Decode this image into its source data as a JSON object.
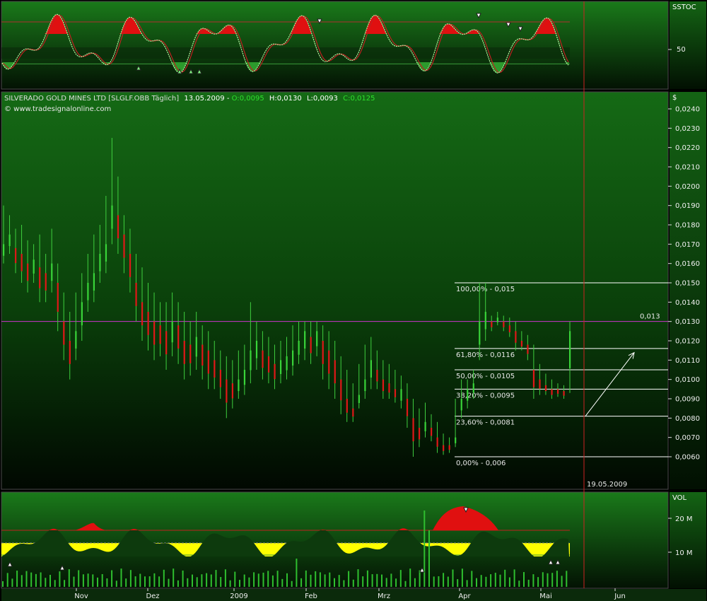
{
  "header": {
    "name": "SILVERADO GOLD MINES LTD [SLGLF.OBB Täglich]",
    "date": "13.05.2009",
    "open_label": "O:",
    "open": "0,0095",
    "high_label": "H:",
    "high": "0,0130",
    "low_label": "L:",
    "low": "0,0093",
    "close_label": "C:",
    "close": "0,0125",
    "copyright": "© www.tradesignalonline.com"
  },
  "panels": {
    "stoch": {
      "name": "SSTOC",
      "tick_label": "50"
    },
    "price": {
      "name": "$"
    },
    "volume": {
      "name": "VOL",
      "tick_labels": [
        "20 M",
        "10 M"
      ]
    }
  },
  "chart_data": {
    "type": "bar",
    "title": "SILVERADO GOLD MINES LTD [SLGLF.OBB Täglich]",
    "x_ticks": [
      "Nov",
      "Dez",
      "2009",
      "Feb",
      "Mrz",
      "Apr",
      "Mai",
      "Jun"
    ],
    "y_ticks": [
      "0,0240",
      "0,0230",
      "0,0220",
      "0,0210",
      "0,0200",
      "0,0190",
      "0,0180",
      "0,0170",
      "0,0160",
      "0,0150",
      "0,0140",
      "0,0130",
      "0,0120",
      "0,0110",
      "0,0100",
      "0,0090",
      "0,0080",
      "0,0070",
      "0,0060"
    ],
    "ylim": [
      0.0055,
      0.0245
    ],
    "horizontal_line": {
      "value": 0.013,
      "label": "0,013",
      "color": "#cc33cc"
    },
    "fibonacci": [
      {
        "label": "100,00% - 0,015",
        "value": 0.015
      },
      {
        "label": "61,80% - 0,0116",
        "value": 0.0116
      },
      {
        "label": "50,00% - 0,0105",
        "value": 0.0105
      },
      {
        "label": "38,20% - 0,0095",
        "value": 0.0095
      },
      {
        "label": "23,60% - 0,0081",
        "value": 0.0081
      },
      {
        "label": "0,00% - 0,006",
        "value": 0.006
      }
    ],
    "vertical_marker": {
      "label": "19.05.2009",
      "color": "#cc2222"
    },
    "arrow": {
      "from": [
        0.0081,
        0
      ],
      "to": [
        0.0115,
        0
      ]
    },
    "series": [
      {
        "name": "",
        "values": [
          [
            0.017,
            0.019,
            0.016
          ],
          [
            0.0175,
            0.0185,
            0.0165
          ],
          [
            0.0168,
            0.0178,
            0.0155
          ],
          [
            0.0165,
            0.018,
            0.015
          ],
          [
            0.016,
            0.0172,
            0.0145
          ],
          [
            0.0162,
            0.017,
            0.015
          ],
          [
            0.0158,
            0.0175,
            0.014
          ],
          [
            0.0155,
            0.0165,
            0.014
          ],
          [
            0.016,
            0.0178,
            0.0145
          ],
          [
            0.015,
            0.016,
            0.0125
          ],
          [
            0.013,
            0.0145,
            0.011
          ],
          [
            0.012,
            0.0135,
            0.01
          ],
          [
            0.0125,
            0.0145,
            0.011
          ],
          [
            0.014,
            0.0155,
            0.012
          ],
          [
            0.015,
            0.0165,
            0.0135
          ],
          [
            0.0155,
            0.0175,
            0.014
          ],
          [
            0.0165,
            0.018,
            0.015
          ],
          [
            0.017,
            0.0195,
            0.0155
          ],
          [
            0.019,
            0.0225,
            0.017
          ],
          [
            0.0185,
            0.0205,
            0.0165
          ],
          [
            0.0175,
            0.0185,
            0.0155
          ],
          [
            0.0165,
            0.0178,
            0.0145
          ],
          [
            0.015,
            0.0165,
            0.013
          ],
          [
            0.014,
            0.0158,
            0.012
          ],
          [
            0.0135,
            0.015,
            0.0115
          ],
          [
            0.013,
            0.0145,
            0.011
          ],
          [
            0.0128,
            0.014,
            0.0112
          ],
          [
            0.0125,
            0.014,
            0.0105
          ],
          [
            0.013,
            0.0145,
            0.0112
          ],
          [
            0.0128,
            0.014,
            0.0108
          ],
          [
            0.012,
            0.0135,
            0.01
          ],
          [
            0.0118,
            0.013,
            0.0102
          ],
          [
            0.0122,
            0.0135,
            0.0105
          ],
          [
            0.0118,
            0.0128,
            0.01
          ],
          [
            0.0115,
            0.0125,
            0.0095
          ],
          [
            0.011,
            0.012,
            0.0095
          ],
          [
            0.0105,
            0.0115,
            0.009
          ],
          [
            0.01,
            0.0112,
            0.008
          ],
          [
            0.0098,
            0.011,
            0.0085
          ],
          [
            0.01,
            0.0115,
            0.009
          ],
          [
            0.0105,
            0.0118,
            0.0092
          ],
          [
            0.0115,
            0.014,
            0.0098
          ],
          [
            0.012,
            0.013,
            0.0105
          ],
          [
            0.0115,
            0.0125,
            0.01
          ],
          [
            0.0112,
            0.0122,
            0.0098
          ],
          [
            0.0108,
            0.0118,
            0.0095
          ],
          [
            0.011,
            0.012,
            0.0098
          ],
          [
            0.0112,
            0.0122,
            0.01
          ],
          [
            0.0115,
            0.0128,
            0.0102
          ],
          [
            0.012,
            0.013,
            0.0108
          ],
          [
            0.0125,
            0.013,
            0.011
          ],
          [
            0.0122,
            0.013,
            0.0108
          ],
          [
            0.0125,
            0.013,
            0.0112
          ],
          [
            0.012,
            0.0128,
            0.01
          ],
          [
            0.0115,
            0.0125,
            0.0095
          ],
          [
            0.011,
            0.012,
            0.009
          ],
          [
            0.01,
            0.0112,
            0.0082
          ],
          [
            0.009,
            0.0105,
            0.0078
          ],
          [
            0.0085,
            0.0098,
            0.0078
          ],
          [
            0.0092,
            0.0108,
            0.0085
          ],
          [
            0.01,
            0.0118,
            0.009
          ],
          [
            0.011,
            0.0122,
            0.0095
          ],
          [
            0.0105,
            0.0115,
            0.0095
          ],
          [
            0.01,
            0.011,
            0.009
          ],
          [
            0.0098,
            0.0108,
            0.009
          ],
          [
            0.0095,
            0.0105,
            0.0088
          ],
          [
            0.0095,
            0.0102,
            0.0085
          ],
          [
            0.009,
            0.0098,
            0.0075
          ],
          [
            0.008,
            0.009,
            0.006
          ],
          [
            0.0075,
            0.0085,
            0.0065
          ],
          [
            0.0078,
            0.0088,
            0.007
          ],
          [
            0.0075,
            0.0082,
            0.0068
          ],
          [
            0.007,
            0.0078,
            0.0062
          ],
          [
            0.0066,
            0.0072,
            0.0061
          ],
          [
            0.0065,
            0.007,
            0.0062
          ],
          [
            0.007,
            0.009,
            0.0065
          ],
          [
            0.009,
            0.01,
            0.008
          ],
          [
            0.0095,
            0.01,
            0.0085
          ],
          [
            0.0098,
            0.0105,
            0.009
          ],
          [
            0.013,
            0.015,
            0.011
          ],
          [
            0.0135,
            0.015,
            0.012
          ],
          [
            0.013,
            0.0133,
            0.0125
          ],
          [
            0.0132,
            0.0135,
            0.0128
          ],
          [
            0.013,
            0.0133,
            0.0125
          ],
          [
            0.0128,
            0.0132,
            0.0122
          ],
          [
            0.0125,
            0.013,
            0.0115
          ],
          [
            0.012,
            0.0125,
            0.0115
          ],
          [
            0.0118,
            0.0123,
            0.011
          ],
          [
            0.0105,
            0.0118,
            0.009
          ],
          [
            0.01,
            0.0108,
            0.0092
          ],
          [
            0.0097,
            0.0103,
            0.0092
          ],
          [
            0.0095,
            0.01,
            0.009
          ],
          [
            0.0094,
            0.0098,
            0.0091
          ],
          [
            0.0093,
            0.0097,
            0.009
          ],
          [
            0.0125,
            0.013,
            0.0093
          ]
        ]
      }
    ],
    "stochastic": {
      "tick": 50
    },
    "volume": {
      "ticks": [
        "20 M",
        "10 M"
      ]
    }
  }
}
